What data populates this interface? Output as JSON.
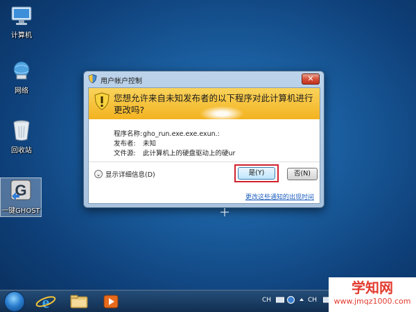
{
  "desktop": {
    "icons": [
      {
        "label": "计算机",
        "icon": "computer-icon"
      },
      {
        "label": "网络",
        "icon": "network-icon"
      },
      {
        "label": "回收站",
        "icon": "recycle-bin-icon"
      },
      {
        "label": "一键GHOST",
        "icon": "ghost-icon"
      }
    ]
  },
  "dialog": {
    "title": "用户帐户控制",
    "close_label": "✕",
    "headline": "您想允许来自未知发布者的以下程序对此计算机进行更改吗?",
    "info": [
      {
        "key": "程序名称:",
        "value": "gho_run.exe.exe.exun.:"
      },
      {
        "key": "发布者:",
        "value": "未知"
      },
      {
        "key": "文件源:",
        "value": "此计算机上的硬盘驱动上的硬ur"
      }
    ],
    "details_label": "显示详细信息(D)",
    "yes_label": "是(Y)",
    "no_label": "否(N)",
    "footer_link": "更改这些通知的出现时间",
    "warning_color": "#f3b321",
    "highlight_color": "#d0202c"
  },
  "taskbar": {
    "items": [
      {
        "icon": "start-orb-icon"
      },
      {
        "icon": "internet-explorer-icon"
      },
      {
        "icon": "folder-icon"
      },
      {
        "icon": "media-player-icon"
      }
    ],
    "tray": {
      "lang_label": "CH",
      "lang_label2": "CH"
    }
  },
  "watermark": {
    "title": "学知网",
    "url": "www.jmqz1000.com"
  }
}
